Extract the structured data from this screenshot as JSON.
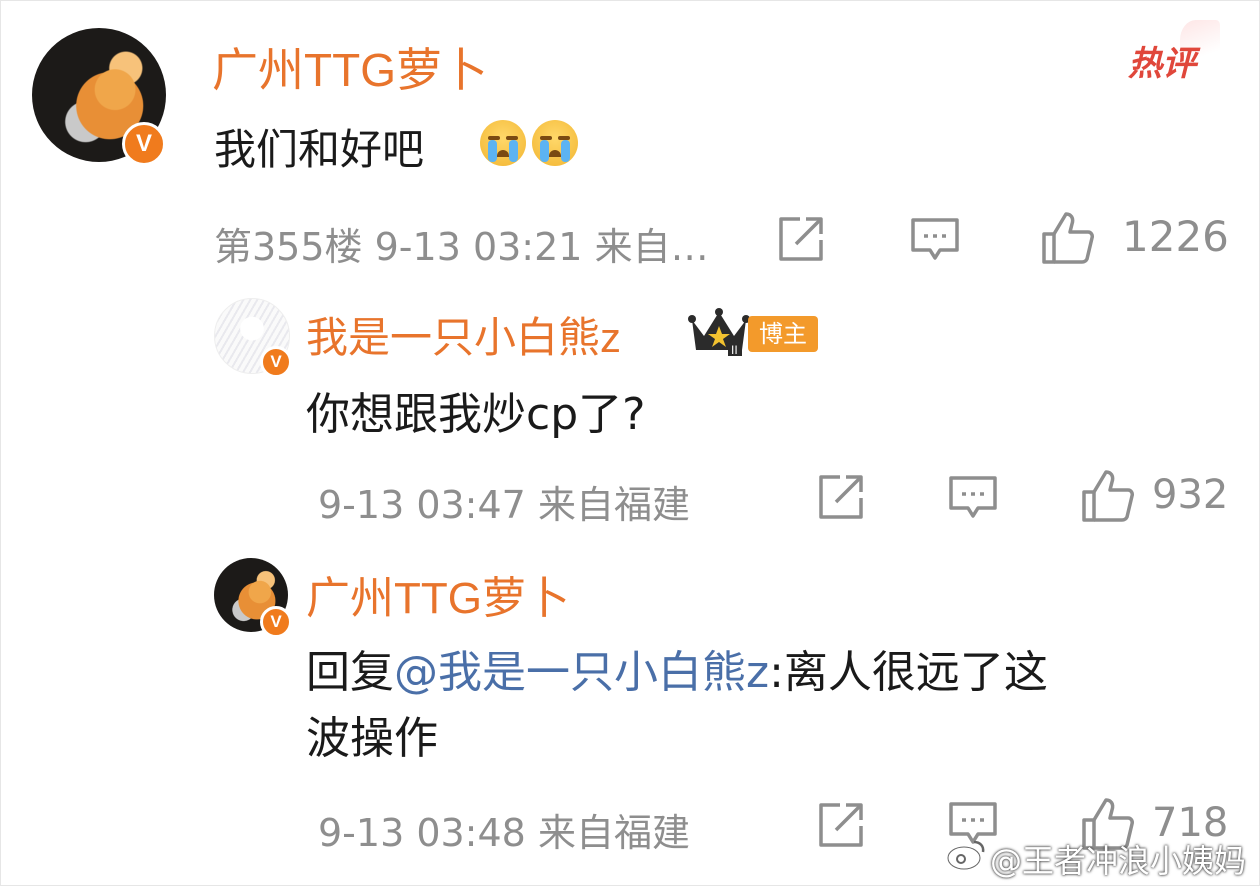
{
  "hot_label": "热评",
  "comment": {
    "author": "广州TTG萝卜",
    "text": "我们和好吧",
    "floor": "第355楼",
    "datetime": "9-13 03:21",
    "source": "来自…",
    "likes": "1226",
    "verified_badge": "V"
  },
  "replies": [
    {
      "author": "我是一只小白熊z",
      "author_tag": "博主",
      "text": "你想跟我炒cp了?",
      "datetime": "9-13 03:47",
      "source": "来自福建",
      "likes": "932",
      "verified_badge": "V"
    },
    {
      "author": "广州TTG萝卜",
      "reply_prefix": "回复",
      "mention": "@我是一只小白熊z",
      "text_line1": ":离人很远了这",
      "text_line2": "波操作",
      "datetime": "9-13 03:48",
      "source": "来自福建",
      "likes": "718",
      "verified_badge": "V"
    }
  ],
  "watermark": "@王者冲浪小姨妈",
  "icons": {
    "share": "share-icon",
    "comment": "comment-icon",
    "like": "thumbs-up-icon",
    "crown": "crown-icon",
    "emoji": "crying-emoji-icon"
  },
  "colors": {
    "name": "#e8742c",
    "mention": "#4a6fa8",
    "meta": "#8e8e8e",
    "hot": "#e0473b",
    "verified": "#f07b1d"
  }
}
